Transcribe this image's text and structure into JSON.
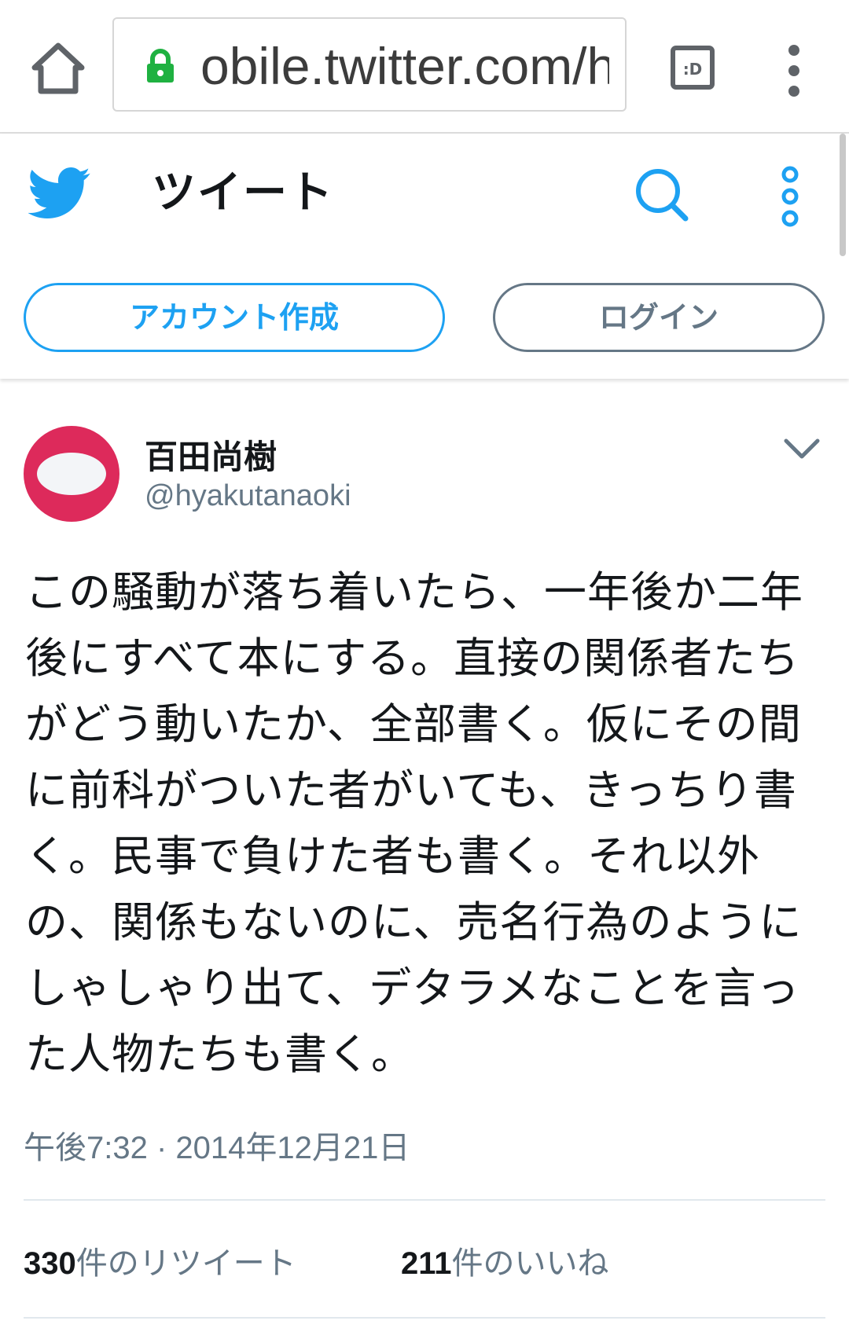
{
  "browser": {
    "url": "obile.twitter.com/h",
    "desktop_icon_text": ":D",
    "colors": {
      "lock": "#1fb141"
    }
  },
  "header": {
    "title": "ツイート",
    "signup_label": "アカウント作成",
    "login_label": "ログイン"
  },
  "tweet": {
    "author_name": "百田尚樹",
    "author_handle": "@hyakutanaoki",
    "text": "この騒動が落ち着いたら、一年後か二年後にすべて本にする。直接の関係者たちがどう動いたか、全部書く。仮にその間に前科がついた者がいても、きっちり書く。民事で負けた者も書く。それ以外の、関係もないのに、売名行為のようにしゃしゃり出て、デタラメなことを言った人物たちも書く。",
    "timestamp": "午後7:32 · 2014年12月21日",
    "retweets": {
      "count": "330",
      "label": "件のリツイート"
    },
    "likes": {
      "count": "211",
      "label": "件のいいね"
    }
  },
  "colors": {
    "twitter_blue": "#1da1f2",
    "text_primary": "#14171a",
    "text_secondary": "#657786",
    "avatar_bg": "#dd2a5b"
  }
}
